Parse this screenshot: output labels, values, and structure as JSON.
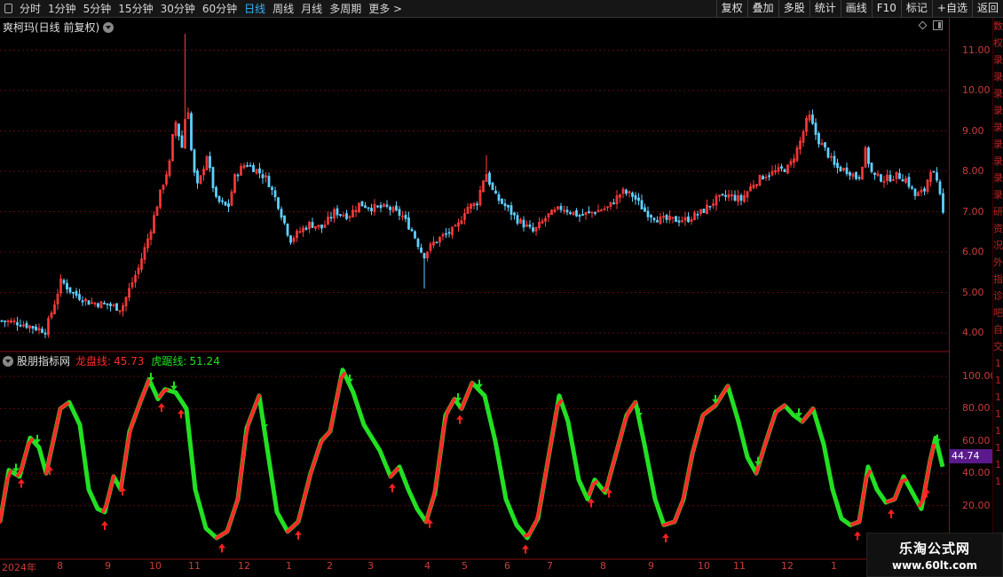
{
  "toolbar": {
    "items": [
      "分时",
      "1分钟",
      "5分钟",
      "15分钟",
      "30分钟",
      "60分钟",
      "日线",
      "周线",
      "月线",
      "多周期",
      "更多 >"
    ],
    "active_index": 6,
    "right_buttons": [
      "复权",
      "叠加",
      "多股",
      "统计",
      "画线",
      "F10",
      "标记",
      "+自选",
      "返回"
    ]
  },
  "price_chart": {
    "title": "爽柯玛(日线 前复权)",
    "y_ticks": [
      "11.00",
      "10.00",
      "9.00",
      "8.00",
      "7.00",
      "6.00",
      "5.00",
      "4.00"
    ],
    "y_values": [
      11,
      10,
      9,
      8,
      7,
      6,
      5,
      4
    ],
    "up_color": "#ff3b3b",
    "down_color": "#5fd0ff"
  },
  "indicator": {
    "name": "股朋指标网",
    "line1_label": "龙盘线:",
    "line1_value": "45.73",
    "line1_color": "#ff2a2a",
    "line2_label": "虎踞线:",
    "line2_value": "51.24",
    "line2_color": "#22e022",
    "y_ticks": [
      "100.00",
      "80.00",
      "60.00",
      "40.00",
      "20.00"
    ],
    "y_values": [
      100,
      80,
      60,
      40,
      20
    ],
    "current_value": "44.74"
  },
  "right_strip": [
    "数",
    "权",
    "录",
    "录",
    "录",
    "录",
    "录",
    "录",
    "录",
    "录",
    "录",
    "研",
    "资",
    "况",
    "外",
    "指",
    "诊",
    "吧",
    "",
    "",
    "",
    "自",
    "交",
    "1",
    "1",
    "1",
    "1",
    "1",
    "1",
    "1",
    "1"
  ],
  "dates": [
    "2024年",
    "8",
    "9",
    "10",
    "11",
    "12",
    "1",
    "2",
    "3",
    "4",
    "5",
    "6",
    "7",
    "8",
    "9",
    "10",
    "11",
    "12",
    "1"
  ],
  "watermark": {
    "line1": "乐淘公式网",
    "line2": "www.60lt.com"
  }
}
